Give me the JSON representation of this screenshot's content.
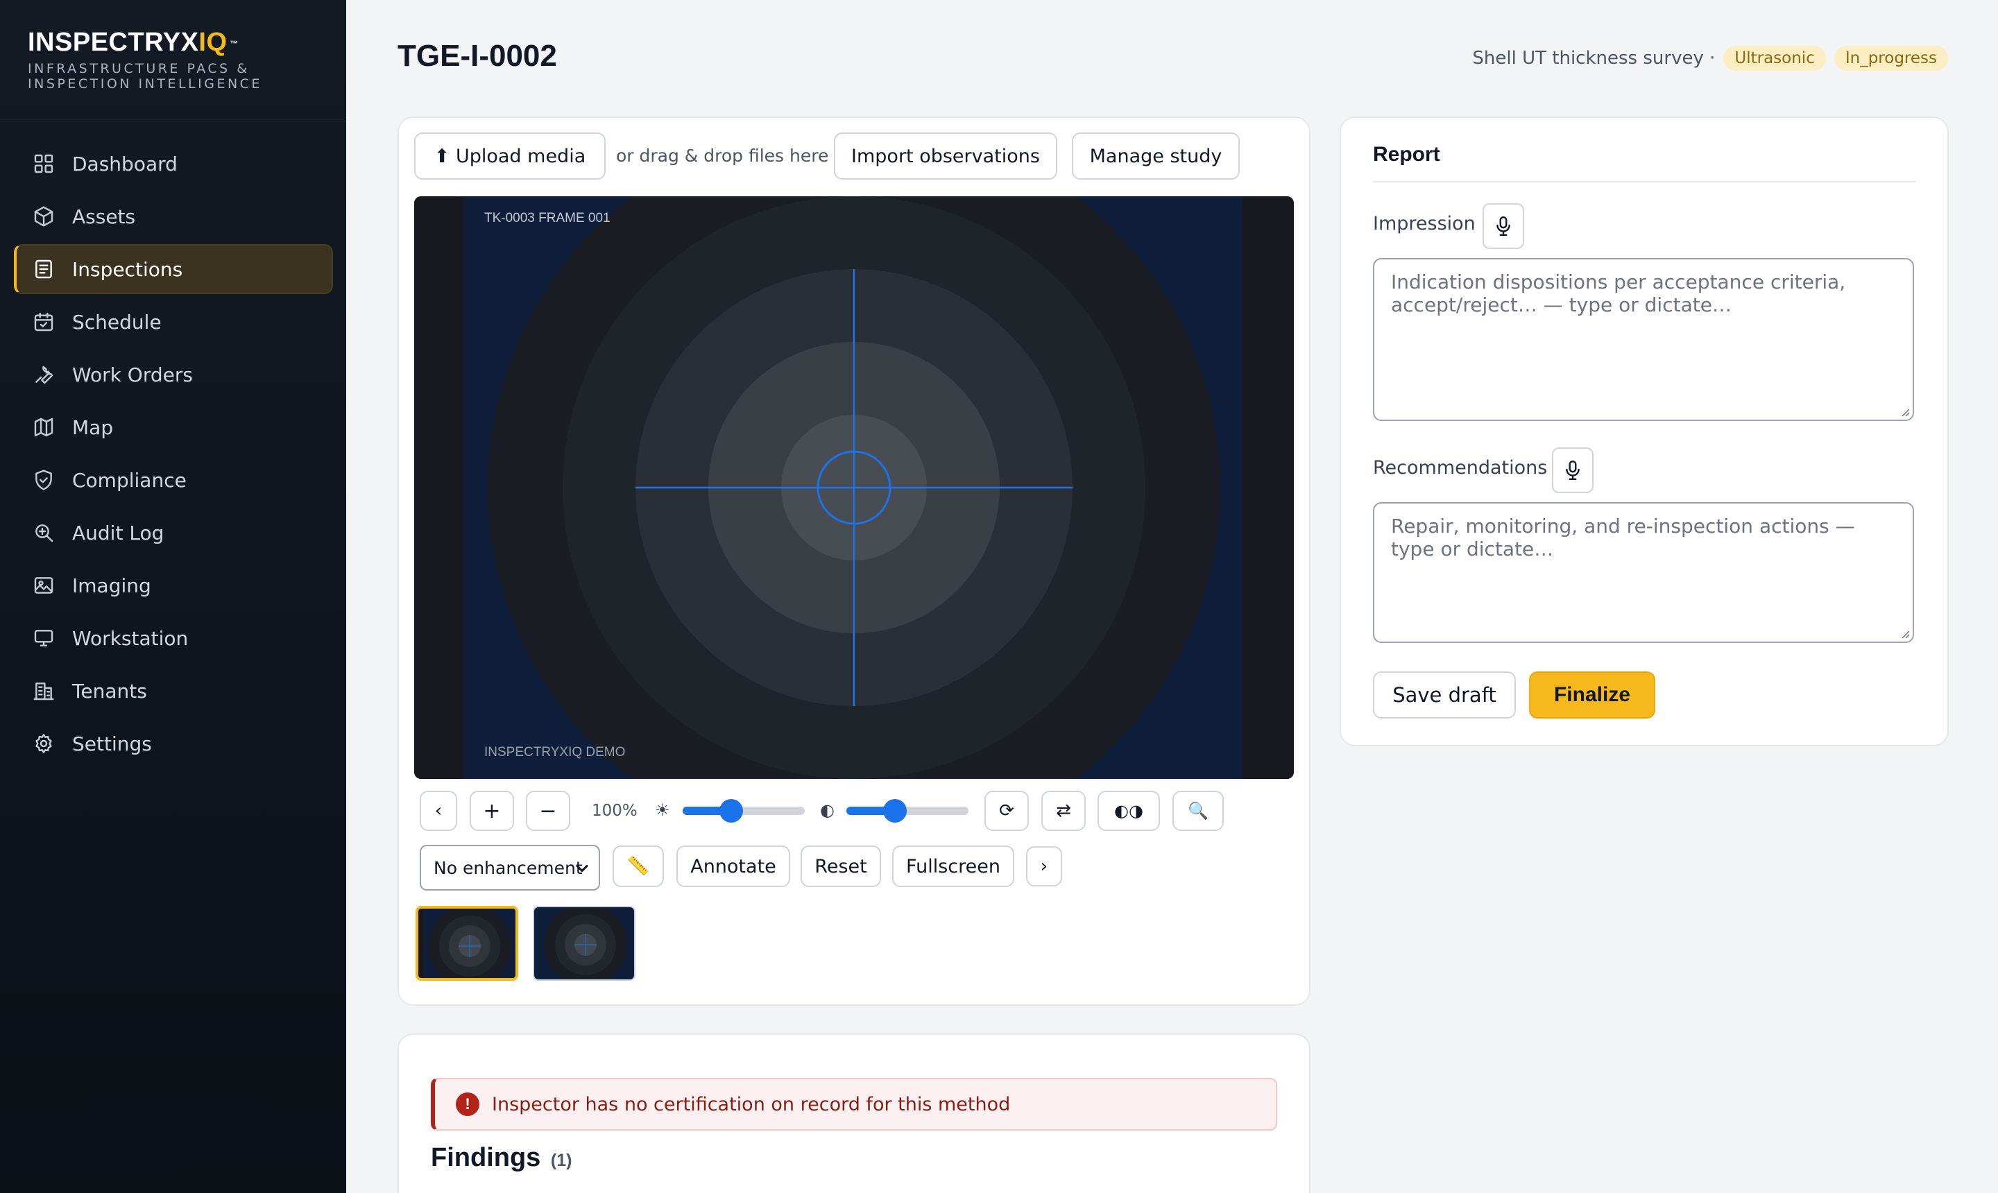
{
  "brand": {
    "name_main": "INSPECTRYX",
    "name_accent": "IQ",
    "trademark": "™",
    "tagline": "INFRASTRUCTURE PACS & INSPECTION INTELLIGENCE"
  },
  "sidebar": {
    "items": [
      {
        "label": "Dashboard",
        "icon": "dashboard-grid-icon",
        "active": false
      },
      {
        "label": "Assets",
        "icon": "cube-icon",
        "active": false
      },
      {
        "label": "Inspections",
        "icon": "document-icon",
        "active": true
      },
      {
        "label": "Schedule",
        "icon": "calendar-icon",
        "active": false
      },
      {
        "label": "Work Orders",
        "icon": "wrench-icon",
        "active": false
      },
      {
        "label": "Map",
        "icon": "map-icon",
        "active": false
      },
      {
        "label": "Compliance",
        "icon": "shield-check-icon",
        "active": false
      },
      {
        "label": "Audit Log",
        "icon": "search-icon",
        "active": false
      },
      {
        "label": "Imaging",
        "icon": "image-icon",
        "active": false
      },
      {
        "label": "Workstation",
        "icon": "monitor-icon",
        "active": false
      },
      {
        "label": "Tenants",
        "icon": "building-icon",
        "active": false
      },
      {
        "label": "Settings",
        "icon": "gear-icon",
        "active": false
      }
    ]
  },
  "header": {
    "title": "TGE-I-0002",
    "subtitle": "Shell UT thickness survey ·",
    "method_badge": "Ultrasonic",
    "status_badge": "In_progress"
  },
  "viewer": {
    "upload_label": "⬆ Upload media",
    "drag_hint": "or drag & drop files here",
    "import_label": "Import observations",
    "manage_label": "Manage study",
    "overlay_top": "TK-0003  FRAME 001",
    "overlay_bottom": "INSPECTRYXIQ DEMO",
    "prev_glyph": "‹",
    "next_glyph": "›",
    "zoom_in_glyph": "+",
    "zoom_out_glyph": "−",
    "zoom_level": "100%",
    "brightness_glyph": "☀",
    "contrast_glyph": "◐",
    "brightness_value": 0.4,
    "contrast_value": 0.4,
    "rotate_glyph": "⟳",
    "flip_glyph": "⇄",
    "invert_glyph": "◐◑",
    "magnify_glyph": "🔍",
    "enhancement_selected": "No enhancement",
    "measure_glyph": "📏",
    "annotate_label": "Annotate",
    "reset_label": "Reset",
    "fullscreen_label": "Fullscreen"
  },
  "report": {
    "title": "Report",
    "impression_label": "Impression",
    "impression_placeholder": "Indication dispositions per acceptance criteria, accept/reject… — type or dictate…",
    "recommendations_label": "Recommendations",
    "recommendations_placeholder": "Repair, monitoring, and re-inspection actions — type or dictate…",
    "save_draft_label": "Save draft",
    "finalize_label": "Finalize"
  },
  "findings": {
    "alert_icon": "!",
    "alert_text": "Inspector has no certification on record for this method",
    "title": "Findings",
    "count": "(1)"
  },
  "colors": {
    "accent": "#f5b91e",
    "sidebar_bg": "#141a24",
    "crosshair": "#1a73e8",
    "alert_red": "#b42318"
  }
}
